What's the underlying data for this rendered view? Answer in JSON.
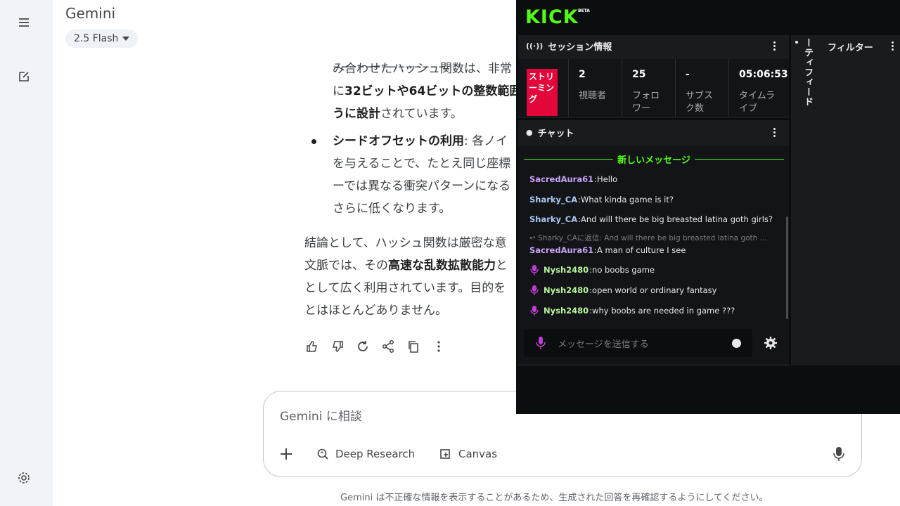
{
  "gemini": {
    "title": "Gemini",
    "model": "2.5 Flash",
    "response": {
      "line0": "み合わせたハッシュ関数は、非常",
      "line1_a": "に",
      "line1_b": "32ビットや64ビットの整数範囲",
      "line2_b": "うに設計",
      "line2_c": "されています。",
      "bullet_bold": "シードオフセットの利用",
      "bullet_rest": ": 各ノイ",
      "bullet_line2": "を与えることで、たとえ同じ座標",
      "bullet_line3": "ーでは異なる衝突パターンになる",
      "bullet_line4": "さらに低くなります。",
      "para_line1": "結論として、ハッシュ関数は厳密な意",
      "para_line2_a": "文脈では、その",
      "para_line2_b": "高速な乱数拡散能力",
      "para_line2_c": "と",
      "para_line3": "として広く利用されています。目的を",
      "para_line4": "とはほとんどありません。"
    },
    "input": {
      "placeholder": "Gemini に相談",
      "tool_deep_research": "Deep Research",
      "tool_canvas": "Canvas"
    },
    "disclaimer": "Gemini は不正確な情報を表示することがあるため、生成された回答を再確認するようにしてください。"
  },
  "kick": {
    "logo": "KICK",
    "beta": "BETA",
    "session": {
      "title": "セッション情報",
      "badge": "ストリーミング",
      "stats": [
        {
          "value": "2",
          "label": "視聴者"
        },
        {
          "value": "25",
          "label": "フォロワー"
        },
        {
          "value": "-",
          "label": "サブスク数"
        },
        {
          "value": "05:06:53",
          "label": "タイムライブ"
        }
      ]
    },
    "chat": {
      "title": "チャット",
      "new_messages": "新しいメッセージ",
      "messages": [
        {
          "user": "SacredAura61",
          "text": " Hello",
          "color": "#c9a3f7"
        },
        {
          "user": "Sharky_CA",
          "text": " What kinda game is it?",
          "color": "#a8c8f0"
        },
        {
          "user": "Sharky_CA",
          "text": " And will there be big breasted latina goth girls?",
          "color": "#a8c8f0"
        },
        {
          "user": "SacredAura61",
          "text": " A man of culture I see",
          "color": "#c9a3f7"
        },
        {
          "user": "Nysh2480",
          "text": " no boobs game",
          "color": "#b7f59b"
        },
        {
          "user": "Nysh2480",
          "text": " open world or ordinary fantasy",
          "color": "#b7f59b"
        },
        {
          "user": "Nysh2480",
          "text": " why boobs are needed in game ???",
          "color": "#b7f59b"
        }
      ],
      "reply_preview": "↩ Sharky_CAに返信: And will there be big breasted latina goth ...",
      "send_placeholder": "メッセージを送信する"
    },
    "side": {
      "vertical_label": "ーティフィード",
      "filter": "フィルター"
    }
  }
}
